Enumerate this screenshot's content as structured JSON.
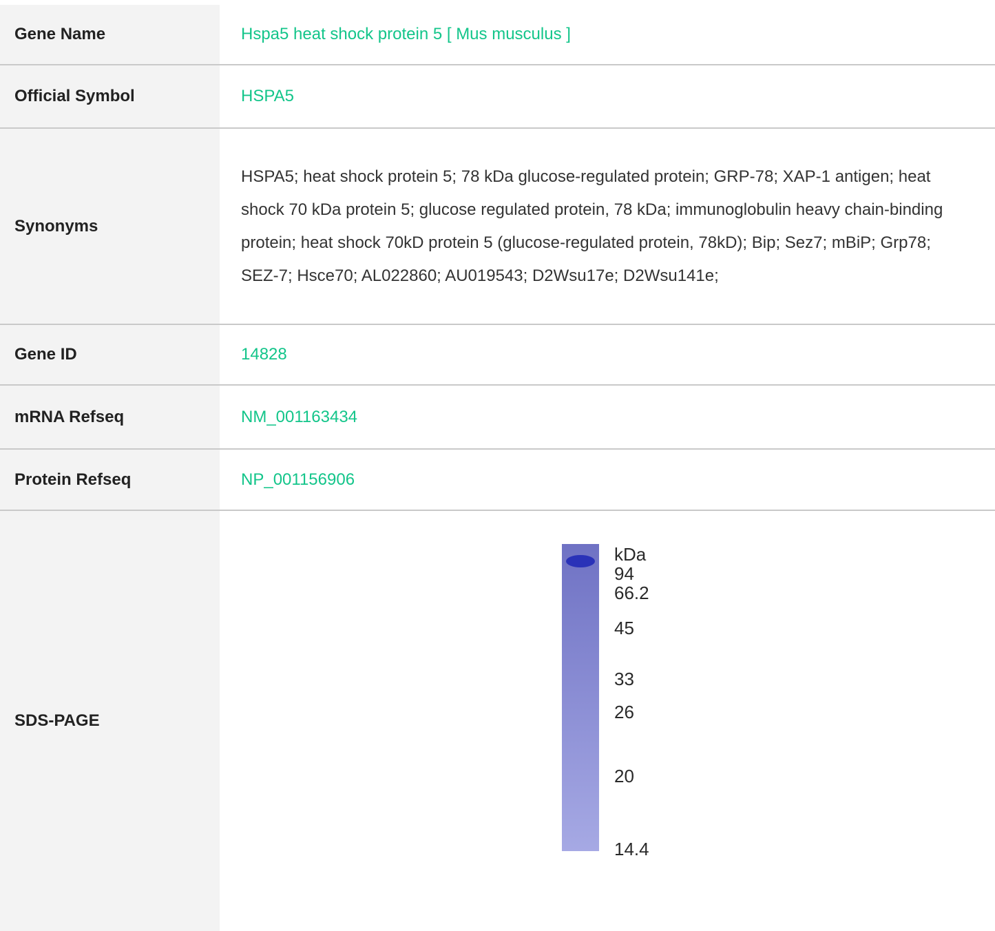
{
  "rows": {
    "gene_name": {
      "label": "Gene Name",
      "value": "Hspa5 heat shock protein 5 [ Mus musculus ]"
    },
    "official_symbol": {
      "label": "Official Symbol",
      "value": "HSPA5"
    },
    "synonyms": {
      "label": "Synonyms",
      "value": "HSPA5; heat shock protein 5; 78 kDa glucose-regulated protein; GRP-78; XAP-1 antigen; heat shock 70 kDa protein 5; glucose regulated protein, 78 kDa; immunoglobulin heavy chain-binding protein; heat shock 70kD protein 5 (glucose-regulated protein, 78kD); Bip; Sez7; mBiP; Grp78; SEZ-7; Hsce70; AL022860; AU019543; D2Wsu17e; D2Wsu141e;"
    },
    "gene_id": {
      "label": "Gene ID",
      "value": "14828"
    },
    "mrna_refseq": {
      "label": "mRNA Refseq",
      "value": "NM_001163434"
    },
    "protein_refseq": {
      "label": "Protein Refseq",
      "value": "NP_001156906"
    },
    "sds_page": {
      "label": "SDS-PAGE"
    }
  },
  "gel": {
    "unit": "kDa",
    "markers": [
      "94",
      "66.2",
      "45",
      "33",
      "26",
      "20",
      "14.4"
    ],
    "lane_color_top": "#6f72c4",
    "lane_color_bottom": "#a6a9e4",
    "band_color": "#2a32b8"
  },
  "colors": {
    "link": "#13c58a",
    "label_bg": "#f3f3f3",
    "divider": "#c9c9c9"
  }
}
